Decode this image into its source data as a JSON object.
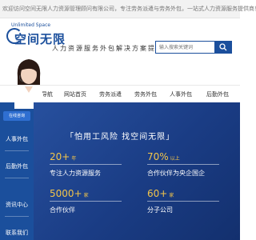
{
  "topbar": {
    "welcome_text": "欢迎访问空间无限人力资源管理顾问有限公司，专注劳务派遣与劳务外包，一站式人力资源服务提供商！"
  },
  "logo": {
    "english": "Unlimited Space",
    "chinese": "空间无限"
  },
  "slogan": "人力资源服务外包解决方案提供商",
  "search": {
    "placeholder": "输入搜索关键词"
  },
  "nav": {
    "items": [
      "网站首页",
      "劳务派遣",
      "劳务外包",
      "人事外包",
      "后勤外包"
    ],
    "partial_item": "导航"
  },
  "sidebar": {
    "online_label": "在线咨询",
    "items": [
      "人事外包",
      "后勤外包",
      "资讯中心",
      "联系我们"
    ]
  },
  "hero": {
    "title": "「怕用工风险 找空间无限」",
    "stats": [
      {
        "value": "20+",
        "unit": "年",
        "label": "专注人力资源服务"
      },
      {
        "value": "70%",
        "unit": "以上",
        "label": "合作伙伴为央企国企"
      },
      {
        "value": "5000+",
        "unit": "家",
        "label": "合作伙伴"
      },
      {
        "value": "60+",
        "unit": "家",
        "label": "分子公司"
      }
    ]
  },
  "colors": {
    "brand": "#1b4f9c",
    "accent": "#f3c54a"
  }
}
